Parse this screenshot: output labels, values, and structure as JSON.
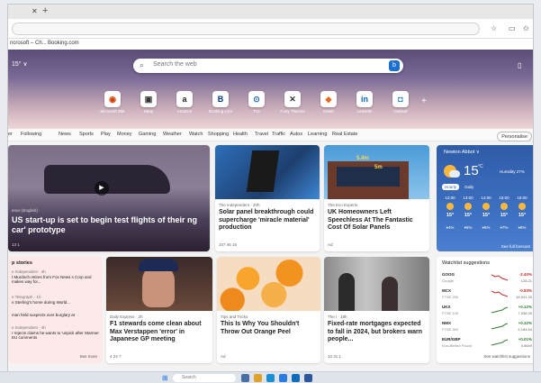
{
  "favbar": {
    "item1": "ncrosoft – Ch...",
    "item2": "Booking.com"
  },
  "hero": {
    "temp": "15° ∨",
    "search_placeholder": "Search the web",
    "tiles": [
      {
        "label": "Microsoft 365",
        "glyph": "◉",
        "color": "#d83b01"
      },
      {
        "label": "eBay",
        "glyph": "▣",
        "color": "#333333"
      },
      {
        "label": "Amazon",
        "glyph": "a",
        "color": "#222222"
      },
      {
        "label": "Booking.com",
        "glyph": "B",
        "color": "#003580"
      },
      {
        "label": "TUI",
        "glyph": "⊙",
        "color": "#1d5fb5"
      },
      {
        "label": "Forty Thieves",
        "glyph": "✕",
        "color": "#333333"
      },
      {
        "label": "Deals",
        "glyph": "◆",
        "color": "#e8671f"
      },
      {
        "label": "LinkedIn",
        "glyph": "in",
        "color": "#0a66c2"
      },
      {
        "label": "Outlook",
        "glyph": "◘",
        "color": "#0f6cbd"
      }
    ]
  },
  "nav": {
    "items": [
      "er",
      "Following",
      "News",
      "Sports",
      "Play",
      "Money",
      "Gaming",
      "Weather",
      "Watch",
      "Shopping",
      "Health",
      "Travel",
      "Traffic",
      "Autos",
      "Learning",
      "Real Estate"
    ],
    "personalize": "Personalise"
  },
  "feature": {
    "source": "ence (English) ·",
    "title": "US start-up is set to begin test flights of their ng car' prototype",
    "stats": "13  1"
  },
  "cards": {
    "solar": {
      "source": "The Independent · 20h",
      "title": "Solar panel breakthrough could supercharge 'miracle material' production",
      "meta": "107   46   15"
    },
    "uk": {
      "source": "The Eco Experts",
      "title": "UK Homeowners Left Speechless At The Fantastic Cost Of Solar Panels",
      "meta": "Ad",
      "dim1": "5.4m",
      "dim2": "5m"
    },
    "f1": {
      "source": "Daily Express · 2h",
      "title": "F1 stewards come clean about Max Verstappen 'error' in Japanese GP meeting",
      "meta": "4   24   7"
    },
    "orange": {
      "source": "Tips and Tricks",
      "title": "This Is Why You Shouldn't Throw Out Orange Peel",
      "meta": "Ad"
    },
    "mortgage": {
      "source": "The i · 18h",
      "title": "Fixed-rate mortgages expected to fall in 2024, but brokers warn people...",
      "meta": "10   31   1"
    }
  },
  "weather": {
    "location": "Newton Abbot ∨",
    "temp": "15",
    "unit": "°C",
    "humidity": "Humidity 27%",
    "tab_hourly": "Hourly",
    "tab_daily": "Daily",
    "hours": [
      {
        "time": "12:00",
        "temp": "15°",
        "rain": "4%"
      },
      {
        "time": "13:00",
        "temp": "15°",
        "rain": "5%"
      },
      {
        "time": "14:00",
        "temp": "15°",
        "rain": "5%"
      },
      {
        "time": "15:00",
        "temp": "15°",
        "rain": "7%"
      },
      {
        "time": "16:00",
        "temp": "15°",
        "rain": "8%"
      }
    ],
    "full_forecast": "See full forecast"
  },
  "watchlist": {
    "title": "Watchlist suggestions",
    "rows": [
      {
        "sym": "GOOG",
        "sub": "Google",
        "change": "-2.40%",
        "price": "128.21",
        "up": false
      },
      {
        "sym": "MCX",
        "sub": "FTSE 250",
        "change": "-0.93%",
        "price": "18,941.33",
        "up": false
      },
      {
        "sym": "UKX",
        "sub": "FTSE 100",
        "change": "+0.12%",
        "price": "7,538.90",
        "up": true
      },
      {
        "sym": "NMX",
        "sub": "FTSE 350",
        "change": "+0.12%",
        "price": "4,184.84",
        "up": true
      },
      {
        "sym": "EUR/GBP",
        "sub": "Euro/British Pound",
        "change": "+0.01%",
        "price": "0.8649",
        "up": true
      }
    ],
    "more": "See watchlist suggestions"
  },
  "topstories": {
    "title": "p stories",
    "items": [
      {
        "src": "e Independent · 4h",
        "text": "t Murdoch retires from Fox News s Corp and makes way for..."
      },
      {
        "src": "e Telegraph · 1h",
        "text": "n Sterling's home during World..."
      },
      {
        "src": "",
        "text": "man held suspects over burglary at"
      },
      {
        "src": "e Independent · 4h",
        "text": "r rejects claims he wants to 'unpick after Starmer EU comments"
      }
    ],
    "more": "See more"
  },
  "taskbar": {
    "search": "Search"
  }
}
